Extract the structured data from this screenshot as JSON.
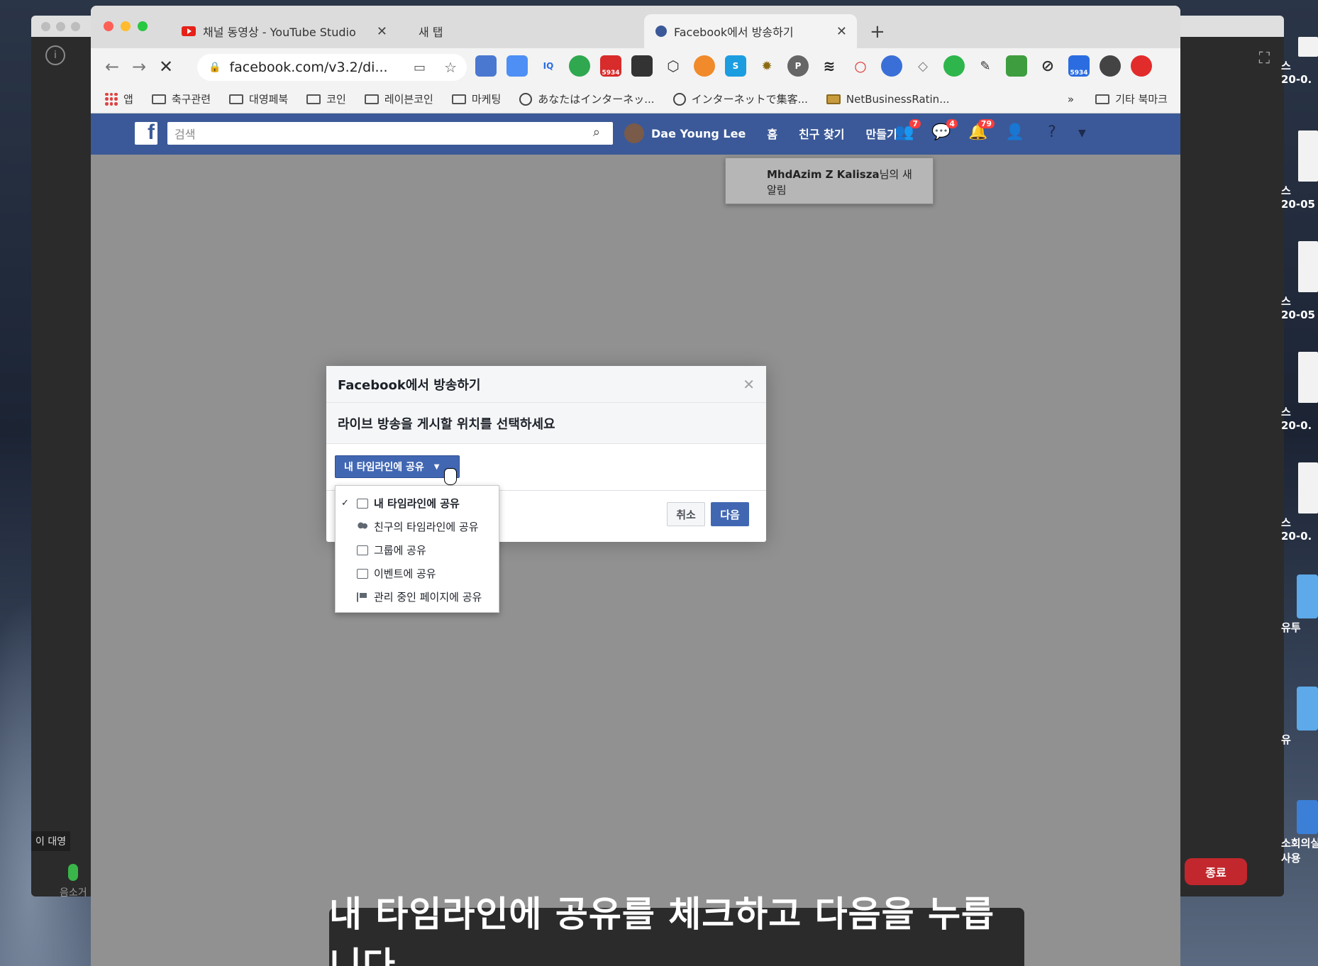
{
  "browser": {
    "tabs": [
      {
        "title": "채널 동영상 - YouTube Studio",
        "favicon": "youtube-icon"
      },
      {
        "title": "새 탭",
        "favicon": ""
      },
      {
        "title": "Facebook에서 방송하기",
        "favicon": "facebook-icon"
      }
    ],
    "url": "facebook.com/v3.2/di...",
    "bookmarks": [
      {
        "label": "앱",
        "icon": "apps-icon"
      },
      {
        "label": "축구관련",
        "icon": "folder-icon"
      },
      {
        "label": "대영페북",
        "icon": "folder-icon"
      },
      {
        "label": "코인",
        "icon": "folder-icon"
      },
      {
        "label": "레이븐코인",
        "icon": "folder-icon"
      },
      {
        "label": "마케팅",
        "icon": "folder-icon"
      },
      {
        "label": "あなたはインターネッ...",
        "icon": "globe-icon"
      },
      {
        "label": "インターネットで集客...",
        "icon": "globe-icon"
      },
      {
        "label": "NetBusinessRatin...",
        "icon": "site-icon"
      }
    ],
    "bookmarks_more": "»",
    "bookmarks_other": "기타 북마크",
    "extension_badge": "5934",
    "extension_badge_2": "5934"
  },
  "facebook": {
    "search_placeholder": "검색",
    "user_name": "Dae Young Lee",
    "nav_home": "홈",
    "nav_find_friends": "친구 찾기",
    "nav_create": "만들기",
    "badge_friends": "7",
    "badge_messages": "4",
    "badge_notifications": "79",
    "notification_user": "MhdAzim Z Kalisza",
    "notification_text": "님의 새 알림"
  },
  "dialog": {
    "title": "Facebook에서 방송하기",
    "subtitle": "라이브 방송을 게시할 위치를 선택하세요",
    "select_value": "내 타임라인에 공유",
    "cancel_label": "취소",
    "next_label": "다음",
    "options": [
      {
        "label": "내 타임라인에 공유",
        "icon": "edit-icon",
        "selected": true
      },
      {
        "label": "친구의 타임라인에 공유",
        "icon": "friends-icon",
        "selected": false
      },
      {
        "label": "그룹에 공유",
        "icon": "group-icon",
        "selected": false
      },
      {
        "label": "이벤트에 공유",
        "icon": "calendar-icon",
        "selected": false
      },
      {
        "label": "관리 중인 페이지에 공유",
        "icon": "flag-icon",
        "selected": false
      }
    ],
    "check_mark": "✓"
  },
  "meeting": {
    "speaker_label": "이 대영",
    "mic_label": "음소거",
    "end_label": "종료"
  },
  "desktop_files": [
    {
      "label": "스",
      "date": "20-0."
    },
    {
      "label": "스",
      "date": "20-05"
    },
    {
      "label": "스",
      "date": "20-05"
    },
    {
      "label": "스",
      "date": "20-0."
    },
    {
      "label": "스",
      "date": "20-0."
    },
    {
      "label": "유투",
      "date": ""
    },
    {
      "label": "유",
      "date": ""
    },
    {
      "label": "소회의실",
      "date": "사용"
    }
  ],
  "caption": "내 타임라인에 공유를 체크하고 다음을 누릅니다.",
  "colors": {
    "facebook_blue": "#3b5998",
    "button_blue": "#4267b2",
    "badge_red": "#fa3e3e",
    "end_red": "#c1272d"
  }
}
